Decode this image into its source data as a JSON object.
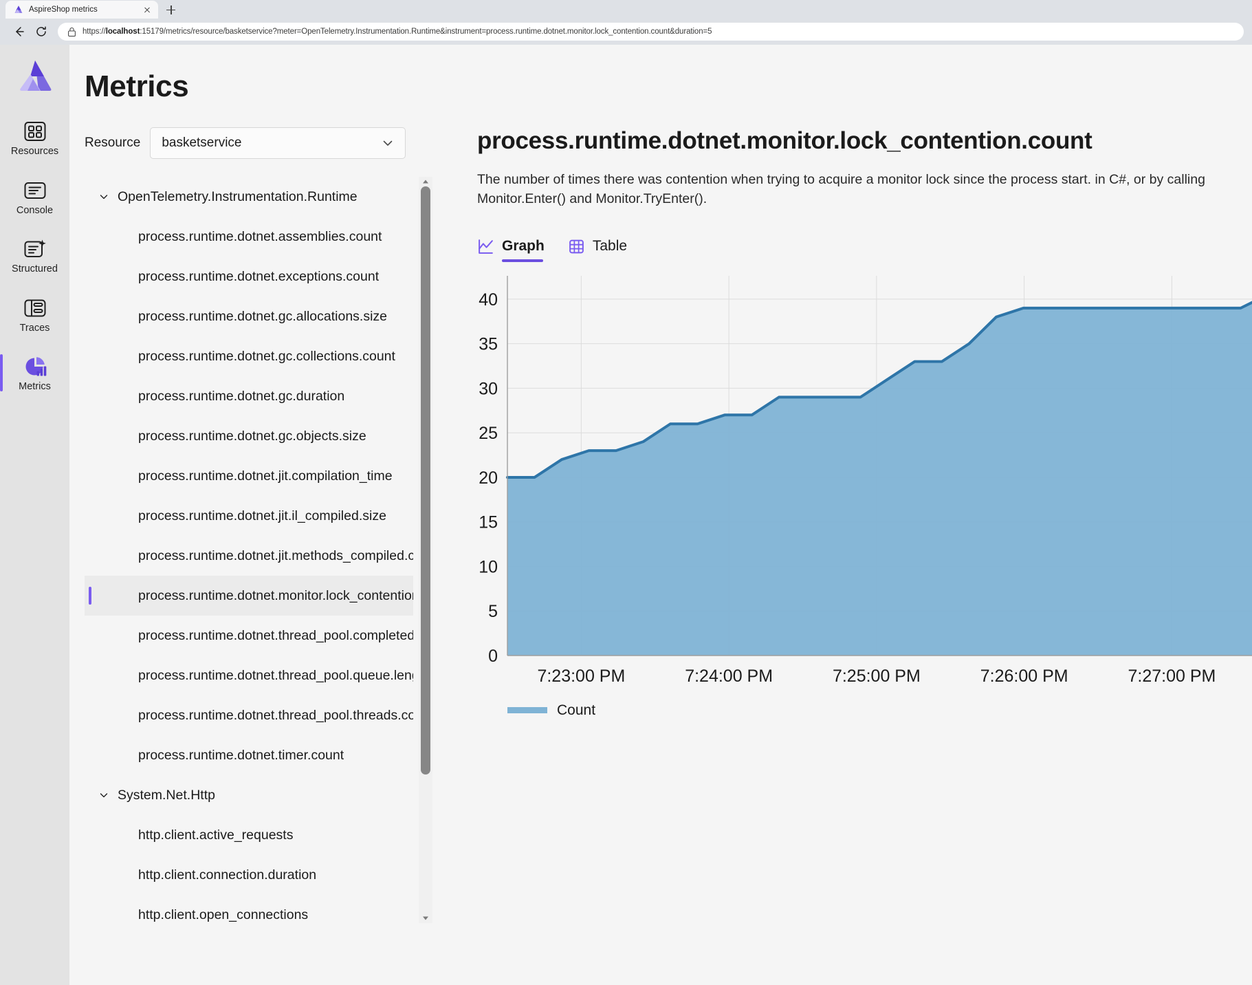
{
  "browser": {
    "tab_title": "AspireShop metrics",
    "url_prefix": "https://",
    "url_host": "localhost",
    "url_rest": ":15179/metrics/resource/basketservice?meter=OpenTelemetry.Instrumentation.Runtime&instrument=process.runtime.dotnet.monitor.lock_contention.count&duration=5",
    "back_icon": "back-arrow-icon",
    "reload_icon": "reload-icon",
    "lock_icon": "lock-icon",
    "new_tab_icon": "new-tab-plus-icon",
    "close_tab_icon": "close-icon"
  },
  "app": {
    "name": "AspireShop",
    "logo_icon": "aspire-logo-icon"
  },
  "rail": {
    "items": [
      {
        "label": "Resources",
        "icon": "grid-icon",
        "active": false
      },
      {
        "label": "Console",
        "icon": "console-icon",
        "active": false
      },
      {
        "label": "Structured",
        "icon": "structured-logs-icon",
        "active": false
      },
      {
        "label": "Traces",
        "icon": "traces-icon",
        "active": false
      },
      {
        "label": "Metrics",
        "icon": "metrics-pie-icon",
        "active": true
      }
    ]
  },
  "page": {
    "title": "Metrics"
  },
  "resource": {
    "label": "Resource",
    "selected": "basketservice",
    "chevron_icon": "chevron-down-icon"
  },
  "tree": {
    "groups": [
      {
        "name": "OpenTelemetry.Instrumentation.Runtime",
        "expanded": true,
        "items": [
          {
            "name": "process.runtime.dotnet.assemblies.count",
            "selected": false
          },
          {
            "name": "process.runtime.dotnet.exceptions.count",
            "selected": false
          },
          {
            "name": "process.runtime.dotnet.gc.allocations.size",
            "selected": false
          },
          {
            "name": "process.runtime.dotnet.gc.collections.count",
            "selected": false
          },
          {
            "name": "process.runtime.dotnet.gc.duration",
            "selected": false
          },
          {
            "name": "process.runtime.dotnet.gc.objects.size",
            "selected": false
          },
          {
            "name": "process.runtime.dotnet.jit.compilation_time",
            "selected": false
          },
          {
            "name": "process.runtime.dotnet.jit.il_compiled.size",
            "selected": false
          },
          {
            "name": "process.runtime.dotnet.jit.methods_compiled.count",
            "selected": false
          },
          {
            "name": "process.runtime.dotnet.monitor.lock_contention.count",
            "selected": true
          },
          {
            "name": "process.runtime.dotnet.thread_pool.completed_items.count",
            "selected": false
          },
          {
            "name": "process.runtime.dotnet.thread_pool.queue.length",
            "selected": false
          },
          {
            "name": "process.runtime.dotnet.thread_pool.threads.count",
            "selected": false
          },
          {
            "name": "process.runtime.dotnet.timer.count",
            "selected": false
          }
        ]
      },
      {
        "name": "System.Net.Http",
        "expanded": true,
        "items": [
          {
            "name": "http.client.active_requests",
            "selected": false
          },
          {
            "name": "http.client.connection.duration",
            "selected": false
          },
          {
            "name": "http.client.open_connections",
            "selected": false
          }
        ]
      }
    ],
    "caret_icon": "chevron-down-icon",
    "scrollbar": {
      "up_icon": "scroll-up-arrow-icon",
      "down_icon": "scroll-down-arrow-icon"
    }
  },
  "detail": {
    "title": "process.runtime.dotnet.monitor.lock_contention.count",
    "description": "The number of times there was contention when trying to acquire a monitor lock since the process start. in C#, or by calling Monitor.Enter() and Monitor.TryEnter().",
    "tabs": [
      {
        "label": "Graph",
        "icon": "graph-icon",
        "active": true
      },
      {
        "label": "Table",
        "icon": "table-grid-icon",
        "active": false
      }
    ]
  },
  "colors": {
    "accent": "#7a5cf0",
    "tab_underline": "#6b4fe0",
    "series_fill": "#7fb3d5",
    "series_line": "#2e75a8",
    "rail_bg": "#e3e3e3",
    "main_bg": "#f5f5f5"
  },
  "chart_data": {
    "type": "area",
    "title": "process.runtime.dotnet.monitor.lock_contention.count",
    "xlabel": "",
    "ylabel": "",
    "ylim": [
      0,
      42
    ],
    "yticks": [
      0,
      5,
      10,
      15,
      20,
      25,
      30,
      35,
      40
    ],
    "xticks": [
      "7:23:00 PM",
      "7:24:00 PM",
      "7:25:00 PM",
      "7:26:00 PM",
      "7:27:00 PM"
    ],
    "grid": true,
    "legend": [
      "Count"
    ],
    "legend_position": "bottom-left",
    "series": [
      {
        "name": "Count",
        "x": [
          0,
          1,
          2,
          3,
          4,
          5,
          6,
          7,
          8,
          9,
          10,
          11,
          12,
          13,
          14,
          15,
          16,
          17,
          18,
          19,
          20,
          21,
          22,
          23,
          24,
          25,
          26,
          27,
          28
        ],
        "values": [
          20,
          20,
          22,
          23,
          23,
          24,
          26,
          26,
          27,
          27,
          29,
          29,
          29,
          29,
          31,
          33,
          33,
          35,
          38,
          39,
          39,
          39,
          39,
          39,
          39,
          39,
          39,
          39,
          40.5
        ]
      }
    ]
  }
}
